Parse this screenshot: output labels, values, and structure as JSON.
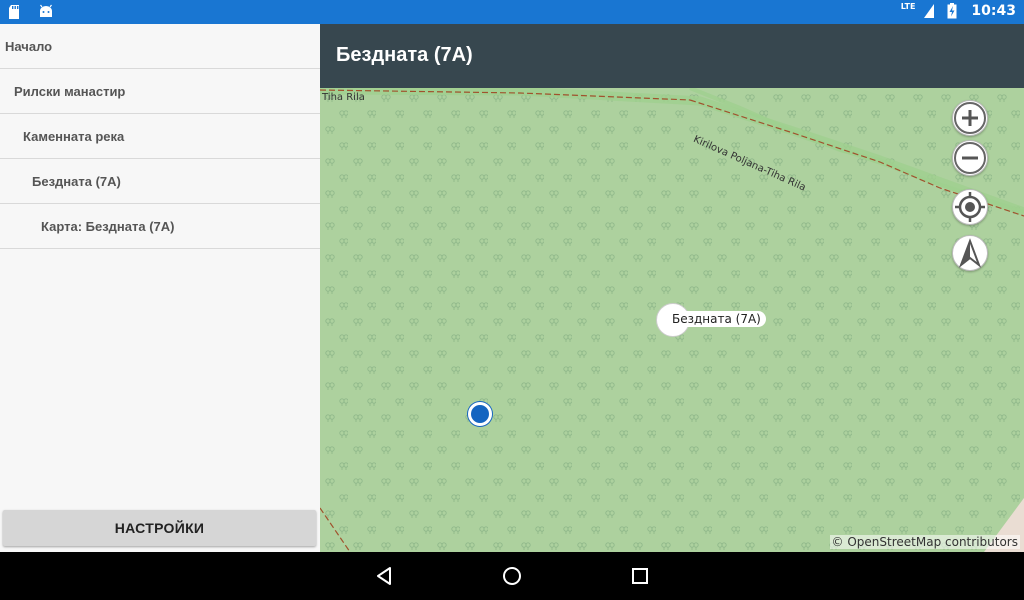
{
  "status_bar": {
    "time": "10:43",
    "network": "LTE"
  },
  "drawer": {
    "items": [
      {
        "label": "Начало"
      },
      {
        "label": "Рилски манастир"
      },
      {
        "label": "Каменната река"
      },
      {
        "label": "Бездната (7A)"
      },
      {
        "label": "Карта: Бездната (7A)"
      }
    ],
    "settings_label": "НАСТРОЙКИ"
  },
  "toolbar": {
    "title": "Бездната (7A)"
  },
  "map": {
    "road_labels": [
      "Tiha Rila",
      "Kirilova Poljana-Tiha Rila"
    ],
    "marker_label": "Бездната (7A)",
    "attribution": "© OpenStreetMap contributors",
    "colors": {
      "forest": "#add19e",
      "location": "#1565C0",
      "trail": "#a0522d"
    }
  }
}
